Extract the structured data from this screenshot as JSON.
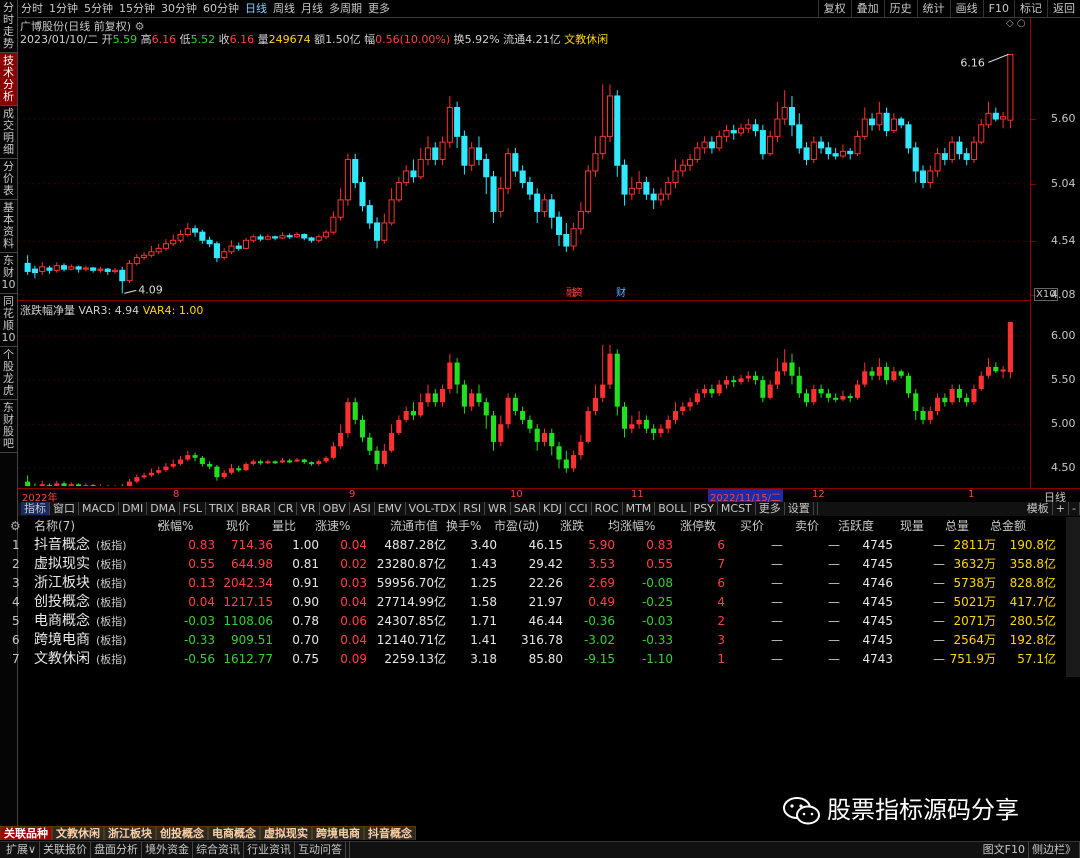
{
  "periods": [
    "分时",
    "1分钟",
    "5分钟",
    "15分钟",
    "30分钟",
    "60分钟",
    "日线",
    "周线",
    "月线",
    "多周期",
    "更多"
  ],
  "active_period": "日线",
  "right_tools": [
    "复权",
    "叠加",
    "历史",
    "统计",
    "画线",
    "F10",
    "标记",
    "返回"
  ],
  "left_tabs": [
    "分时走势",
    "技术分析",
    "成交明细",
    "分价表",
    "基本资料",
    "东财10",
    "同花顺10",
    "个股龙虎",
    "东财股吧"
  ],
  "active_left_tab": "技术分析",
  "stock": {
    "name": "广博股份",
    "mode": "(日线 前复权)",
    "date": "2023/01/10/二"
  },
  "quote": [
    {
      "k": "开",
      "v": "5.59",
      "c": "g"
    },
    {
      "k": "高",
      "v": "6.16",
      "c": "r"
    },
    {
      "k": "低",
      "v": "5.52",
      "c": "g"
    },
    {
      "k": "收",
      "v": "6.16",
      "c": "r"
    },
    {
      "k": "量",
      "v": "249674",
      "c": "y"
    },
    {
      "k": "额",
      "v": "1.50亿",
      "c": "w"
    },
    {
      "k": "幅",
      "v": "0.56(10.00%)",
      "c": "r"
    },
    {
      "k": "换",
      "v": "5.92%",
      "c": "w"
    },
    {
      "k": "流通",
      "v": "4.21亿",
      "c": "w"
    },
    {
      "k": "",
      "v": "文教休闲",
      "c": "y"
    }
  ],
  "price_axis": [
    "5.60",
    "5.04",
    "4.54",
    "4.08"
  ],
  "high_label": "6.16",
  "low_label": "4.09",
  "axis_x10": "X10",
  "events": [
    {
      "t": "融",
      "c": "#ff4040"
    },
    {
      "t": "资",
      "c": "#ff4040"
    },
    {
      "t": "财",
      "c": "#60b0ff"
    }
  ],
  "sub": {
    "name": "涨跌幅净量",
    "var3_label": "VAR3: 4.94",
    "var4_label": "VAR4: 1.00"
  },
  "sub_axis": [
    "6.00",
    "5.50",
    "5.00",
    "4.50"
  ],
  "dates": [
    "2022年",
    "8",
    "9",
    "10",
    "11",
    "2022/11/15/二",
    "12",
    "1"
  ],
  "rightnav": "日线",
  "indicators": [
    "指标",
    "窗口",
    "MACD",
    "DMI",
    "DMA",
    "FSL",
    "TRIX",
    "BRAR",
    "CR",
    "VR",
    "OBV",
    "ASI",
    "EMV",
    "VOL-TDX",
    "RSI",
    "WR",
    "SAR",
    "KDJ",
    "CCI",
    "ROC",
    "MTM",
    "BOLL",
    "PSY",
    "MCST",
    "更多",
    "设置"
  ],
  "ind_right": [
    "模板",
    "+",
    "-"
  ],
  "table_headers": [
    "名称(7)",
    "涨幅%",
    "现价",
    "量比",
    "涨速%",
    "流通市值",
    "换手%",
    "市盈(动)",
    "涨跌",
    "均涨幅%",
    "涨停数",
    "买价",
    "卖价",
    "活跃度",
    "现量",
    "总量",
    "总金额"
  ],
  "rows": [
    [
      "1",
      "抖音概念",
      "(板指)",
      "0.83",
      "714.36",
      "1.00",
      "0.04",
      "4887.28亿",
      "3.40",
      "46.15",
      "5.90",
      "0.83",
      "6",
      "—",
      "—",
      "4745",
      "—",
      "2811万",
      "190.8亿"
    ],
    [
      "2",
      "虚拟现实",
      "(板指)",
      "0.55",
      "644.98",
      "0.81",
      "0.02",
      "23280.87亿",
      "1.43",
      "29.42",
      "3.53",
      "0.55",
      "7",
      "—",
      "—",
      "4745",
      "—",
      "3632万",
      "358.8亿"
    ],
    [
      "3",
      "浙江板块",
      "(板指)",
      "0.13",
      "2042.34",
      "0.91",
      "0.03",
      "59956.70亿",
      "1.25",
      "22.26",
      "2.69",
      "-0.08",
      "6",
      "—",
      "—",
      "4746",
      "—",
      "5738万",
      "828.8亿"
    ],
    [
      "4",
      "创投概念",
      "(板指)",
      "0.04",
      "1217.15",
      "0.90",
      "0.04",
      "27714.99亿",
      "1.58",
      "21.97",
      "0.49",
      "-0.25",
      "4",
      "—",
      "—",
      "4745",
      "—",
      "5021万",
      "417.7亿"
    ],
    [
      "5",
      "电商概念",
      "(板指)",
      "-0.03",
      "1108.06",
      "0.78",
      "0.06",
      "24307.85亿",
      "1.71",
      "46.44",
      "-0.36",
      "-0.03",
      "2",
      "—",
      "—",
      "4745",
      "—",
      "2071万",
      "280.5亿"
    ],
    [
      "6",
      "跨境电商",
      "(板指)",
      "-0.33",
      "909.51",
      "0.70",
      "0.04",
      "12140.71亿",
      "1.41",
      "316.78",
      "-3.02",
      "-0.33",
      "3",
      "—",
      "—",
      "4745",
      "—",
      "2564万",
      "192.8亿"
    ],
    [
      "7",
      "文教休闲",
      "(板指)",
      "-0.56",
      "1612.77",
      "0.75",
      "0.09",
      "2259.13亿",
      "3.18",
      "85.80",
      "-9.15",
      "-1.10",
      "1",
      "—",
      "—",
      "4743",
      "—",
      "751.9万",
      "57.1亿"
    ]
  ],
  "bottom_tabs": [
    "关联品种",
    "文教休闲",
    "浙江板块",
    "创投概念",
    "电商概念",
    "虚拟现实",
    "跨境电商",
    "抖音概念"
  ],
  "bottom_bar": [
    "扩展∨",
    "关联报价",
    "盘面分析",
    "境外资金",
    "综合资讯",
    "行业资讯",
    "互动问答"
  ],
  "bottom_right": [
    "图文F10",
    "侧边栏》"
  ],
  "watermark": "股票指标源码分享",
  "colors": {
    "up": "#ff3030",
    "down": "#30e8ff",
    "sub_down": "#20e020",
    "panel_border": "#8a0000"
  },
  "chart_data": {
    "type": "candlestick",
    "y_range": [
      4.05,
      6.25
    ],
    "candles": [
      [
        4.35,
        4.28,
        4.42,
        4.25
      ],
      [
        4.3,
        4.27,
        4.33,
        4.22
      ],
      [
        4.28,
        4.32,
        4.36,
        4.25
      ],
      [
        4.31,
        4.29,
        4.33,
        4.26
      ],
      [
        4.29,
        4.33,
        4.36,
        4.27
      ],
      [
        4.33,
        4.3,
        4.35,
        4.28
      ],
      [
        4.3,
        4.32,
        4.34,
        4.29
      ],
      [
        4.32,
        4.3,
        4.33,
        4.27
      ],
      [
        4.3,
        4.31,
        4.33,
        4.28
      ],
      [
        4.31,
        4.29,
        4.32,
        4.27
      ],
      [
        4.29,
        4.3,
        4.32,
        4.27
      ],
      [
        4.3,
        4.28,
        4.31,
        4.25
      ],
      [
        4.28,
        4.29,
        4.31,
        4.26
      ],
      [
        4.29,
        4.2,
        4.32,
        4.09
      ],
      [
        4.2,
        4.35,
        4.38,
        4.18
      ],
      [
        4.35,
        4.4,
        4.43,
        4.33
      ],
      [
        4.4,
        4.42,
        4.45,
        4.38
      ],
      [
        4.42,
        4.45,
        4.5,
        4.4
      ],
      [
        4.45,
        4.48,
        4.52,
        4.43
      ],
      [
        4.48,
        4.52,
        4.56,
        4.46
      ],
      [
        4.52,
        4.55,
        4.6,
        4.5
      ],
      [
        4.55,
        4.6,
        4.64,
        4.53
      ],
      [
        4.6,
        4.65,
        4.7,
        4.58
      ],
      [
        4.65,
        4.62,
        4.68,
        4.58
      ],
      [
        4.62,
        4.55,
        4.64,
        4.52
      ],
      [
        4.55,
        4.52,
        4.58,
        4.49
      ],
      [
        4.52,
        4.4,
        4.54,
        4.36
      ],
      [
        4.4,
        4.45,
        4.48,
        4.38
      ],
      [
        4.45,
        4.5,
        4.55,
        4.43
      ],
      [
        4.5,
        4.48,
        4.53,
        4.46
      ],
      [
        4.48,
        4.55,
        4.57,
        4.47
      ],
      [
        4.55,
        4.58,
        4.6,
        4.53
      ],
      [
        4.58,
        4.56,
        4.6,
        4.54
      ],
      [
        4.56,
        4.58,
        4.6,
        4.55
      ],
      [
        4.58,
        4.57,
        4.59,
        4.55
      ],
      [
        4.57,
        4.59,
        4.62,
        4.56
      ],
      [
        4.59,
        4.58,
        4.61,
        4.56
      ],
      [
        4.58,
        4.6,
        4.62,
        4.57
      ],
      [
        4.6,
        4.57,
        4.61,
        4.55
      ],
      [
        4.57,
        4.55,
        4.58,
        4.53
      ],
      [
        4.55,
        4.58,
        4.6,
        4.53
      ],
      [
        4.58,
        4.62,
        4.64,
        4.56
      ],
      [
        4.62,
        4.75,
        4.8,
        4.6
      ],
      [
        4.75,
        4.9,
        5.0,
        4.72
      ],
      [
        4.9,
        5.25,
        5.3,
        4.85
      ],
      [
        5.25,
        5.05,
        5.3,
        5.0
      ],
      [
        5.05,
        4.85,
        5.1,
        4.8
      ],
      [
        4.85,
        4.7,
        4.9,
        4.65
      ],
      [
        4.7,
        4.55,
        4.75,
        4.48
      ],
      [
        4.55,
        4.7,
        4.78,
        4.52
      ],
      [
        4.7,
        4.9,
        5.0,
        4.68
      ],
      [
        4.9,
        5.05,
        5.1,
        4.88
      ],
      [
        5.05,
        5.15,
        5.2,
        5.02
      ],
      [
        5.15,
        5.1,
        5.25,
        5.05
      ],
      [
        5.1,
        5.25,
        5.35,
        5.08
      ],
      [
        5.25,
        5.35,
        5.45,
        5.2
      ],
      [
        5.35,
        5.25,
        5.4,
        5.2
      ],
      [
        5.25,
        5.4,
        5.45,
        5.2
      ],
      [
        5.4,
        5.7,
        5.8,
        5.35
      ],
      [
        5.7,
        5.45,
        5.75,
        5.35
      ],
      [
        5.45,
        5.2,
        5.5,
        5.12
      ],
      [
        5.2,
        5.35,
        5.4,
        5.15
      ],
      [
        5.35,
        5.25,
        5.45,
        5.2
      ],
      [
        5.25,
        5.1,
        5.3,
        4.95
      ],
      [
        5.1,
        4.8,
        5.15,
        4.7
      ],
      [
        4.8,
        5.0,
        5.1,
        4.75
      ],
      [
        5.0,
        5.3,
        5.35,
        4.95
      ],
      [
        5.3,
        5.15,
        5.35,
        5.1
      ],
      [
        5.15,
        5.05,
        5.2,
        5.0
      ],
      [
        5.05,
        4.95,
        5.1,
        4.9
      ],
      [
        4.95,
        4.8,
        5.0,
        4.7
      ],
      [
        4.8,
        4.9,
        4.95,
        4.75
      ],
      [
        4.9,
        4.75,
        4.95,
        4.65
      ],
      [
        4.75,
        4.6,
        4.8,
        4.5
      ],
      [
        4.6,
        4.5,
        4.7,
        4.45
      ],
      [
        4.5,
        4.65,
        4.7,
        4.46
      ],
      [
        4.65,
        4.8,
        4.88,
        4.6
      ],
      [
        4.8,
        5.15,
        5.2,
        4.78
      ],
      [
        5.15,
        5.3,
        5.45,
        5.1
      ],
      [
        5.3,
        5.45,
        5.9,
        5.25
      ],
      [
        5.45,
        5.8,
        5.9,
        5.4
      ],
      [
        5.8,
        5.2,
        5.85,
        5.1
      ],
      [
        5.2,
        4.95,
        5.25,
        4.85
      ],
      [
        4.95,
        5.0,
        5.1,
        4.9
      ],
      [
        5.0,
        5.05,
        5.15,
        4.95
      ],
      [
        5.05,
        4.95,
        5.1,
        4.9
      ],
      [
        4.95,
        4.9,
        5.0,
        4.82
      ],
      [
        4.9,
        4.95,
        5.0,
        4.85
      ],
      [
        4.95,
        5.05,
        5.1,
        4.9
      ],
      [
        5.05,
        5.15,
        5.25,
        5.0
      ],
      [
        5.15,
        5.2,
        5.25,
        5.1
      ],
      [
        5.2,
        5.25,
        5.3,
        5.15
      ],
      [
        5.25,
        5.35,
        5.4,
        5.22
      ],
      [
        5.35,
        5.4,
        5.45,
        5.3
      ],
      [
        5.4,
        5.35,
        5.45,
        5.3
      ],
      [
        5.35,
        5.45,
        5.5,
        5.32
      ],
      [
        5.45,
        5.5,
        5.55,
        5.4
      ],
      [
        5.5,
        5.48,
        5.55,
        5.42
      ],
      [
        5.48,
        5.52,
        5.56,
        5.45
      ],
      [
        5.52,
        5.55,
        5.6,
        5.48
      ],
      [
        5.55,
        5.5,
        5.6,
        5.45
      ],
      [
        5.5,
        5.3,
        5.55,
        5.25
      ],
      [
        5.3,
        5.45,
        5.5,
        5.28
      ],
      [
        5.45,
        5.6,
        5.75,
        5.4
      ],
      [
        5.6,
        5.7,
        5.85,
        5.55
      ],
      [
        5.7,
        5.55,
        5.8,
        5.45
      ],
      [
        5.55,
        5.35,
        5.65,
        5.3
      ],
      [
        5.35,
        5.25,
        5.4,
        5.2
      ],
      [
        5.25,
        5.4,
        5.45,
        5.22
      ],
      [
        5.4,
        5.35,
        5.45,
        5.3
      ],
      [
        5.35,
        5.3,
        5.4,
        5.25
      ],
      [
        5.3,
        5.28,
        5.35,
        5.25
      ],
      [
        5.28,
        5.32,
        5.38,
        5.26
      ],
      [
        5.32,
        5.3,
        5.35,
        5.25
      ],
      [
        5.3,
        5.45,
        5.5,
        5.28
      ],
      [
        5.45,
        5.6,
        5.7,
        5.42
      ],
      [
        5.6,
        5.55,
        5.65,
        5.5
      ],
      [
        5.55,
        5.65,
        5.75,
        5.5
      ],
      [
        5.65,
        5.5,
        5.7,
        5.45
      ],
      [
        5.5,
        5.6,
        5.65,
        5.48
      ],
      [
        5.6,
        5.55,
        5.62,
        5.52
      ],
      [
        5.55,
        5.35,
        5.58,
        5.3
      ],
      [
        5.35,
        5.15,
        5.4,
        5.05
      ],
      [
        5.15,
        5.05,
        5.2,
        5.0
      ],
      [
        5.05,
        5.15,
        5.2,
        5.0
      ],
      [
        5.15,
        5.3,
        5.35,
        5.1
      ],
      [
        5.3,
        5.25,
        5.35,
        5.2
      ],
      [
        5.25,
        5.4,
        5.45,
        5.22
      ],
      [
        5.4,
        5.3,
        5.45,
        5.25
      ],
      [
        5.3,
        5.25,
        5.35,
        5.2
      ],
      [
        5.25,
        5.4,
        5.45,
        5.22
      ],
      [
        5.4,
        5.55,
        5.6,
        5.38
      ],
      [
        5.55,
        5.65,
        5.75,
        5.52
      ],
      [
        5.65,
        5.6,
        5.7,
        5.58
      ],
      [
        5.6,
        5.62,
        5.66,
        5.52
      ],
      [
        5.59,
        6.16,
        6.16,
        5.52
      ]
    ]
  }
}
